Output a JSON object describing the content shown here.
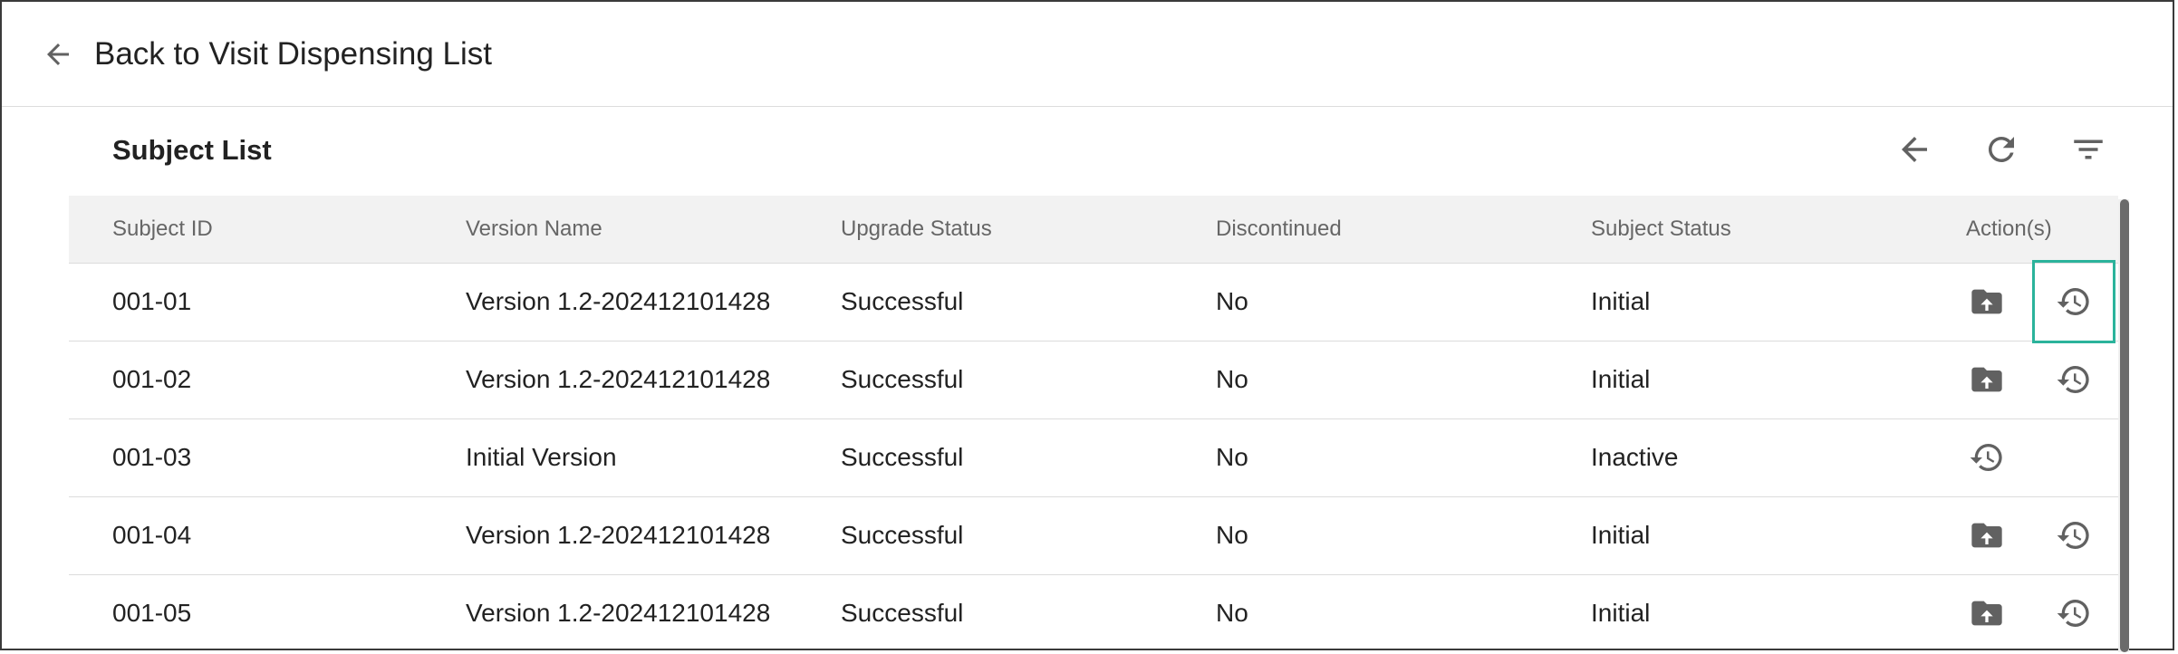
{
  "header": {
    "back_label": "Back to Visit Dispensing List"
  },
  "card": {
    "title": "Subject List"
  },
  "table": {
    "columns": [
      "Subject ID",
      "Version Name",
      "Upgrade Status",
      "Discontinued",
      "Subject Status",
      "Action(s)"
    ],
    "rows": [
      {
        "subject_id": "001-01",
        "version_name": "Version 1.2-202412101428",
        "upgrade_status": "Successful",
        "discontinued": "No",
        "subject_status": "Initial"
      },
      {
        "subject_id": "001-02",
        "version_name": "Version 1.2-202412101428",
        "upgrade_status": "Successful",
        "discontinued": "No",
        "subject_status": "Initial"
      },
      {
        "subject_id": "001-03",
        "version_name": "Initial Version",
        "upgrade_status": "Successful",
        "discontinued": "No",
        "subject_status": "Inactive"
      },
      {
        "subject_id": "001-04",
        "version_name": "Version 1.2-202412101428",
        "upgrade_status": "Successful",
        "discontinued": "No",
        "subject_status": "Initial"
      },
      {
        "subject_id": "001-05",
        "version_name": "Version 1.2-202412101428",
        "upgrade_status": "Successful",
        "discontinued": "No",
        "subject_status": "Initial"
      }
    ]
  },
  "icons": {
    "back": "arrow-left-icon",
    "refresh": "refresh-icon",
    "filter": "filter-icon",
    "upgrade": "folder-upload-icon",
    "history": "history-icon"
  },
  "colors": {
    "highlight": "#2bb39b",
    "icon": "#616161",
    "header_bg": "#f2f2f2"
  }
}
